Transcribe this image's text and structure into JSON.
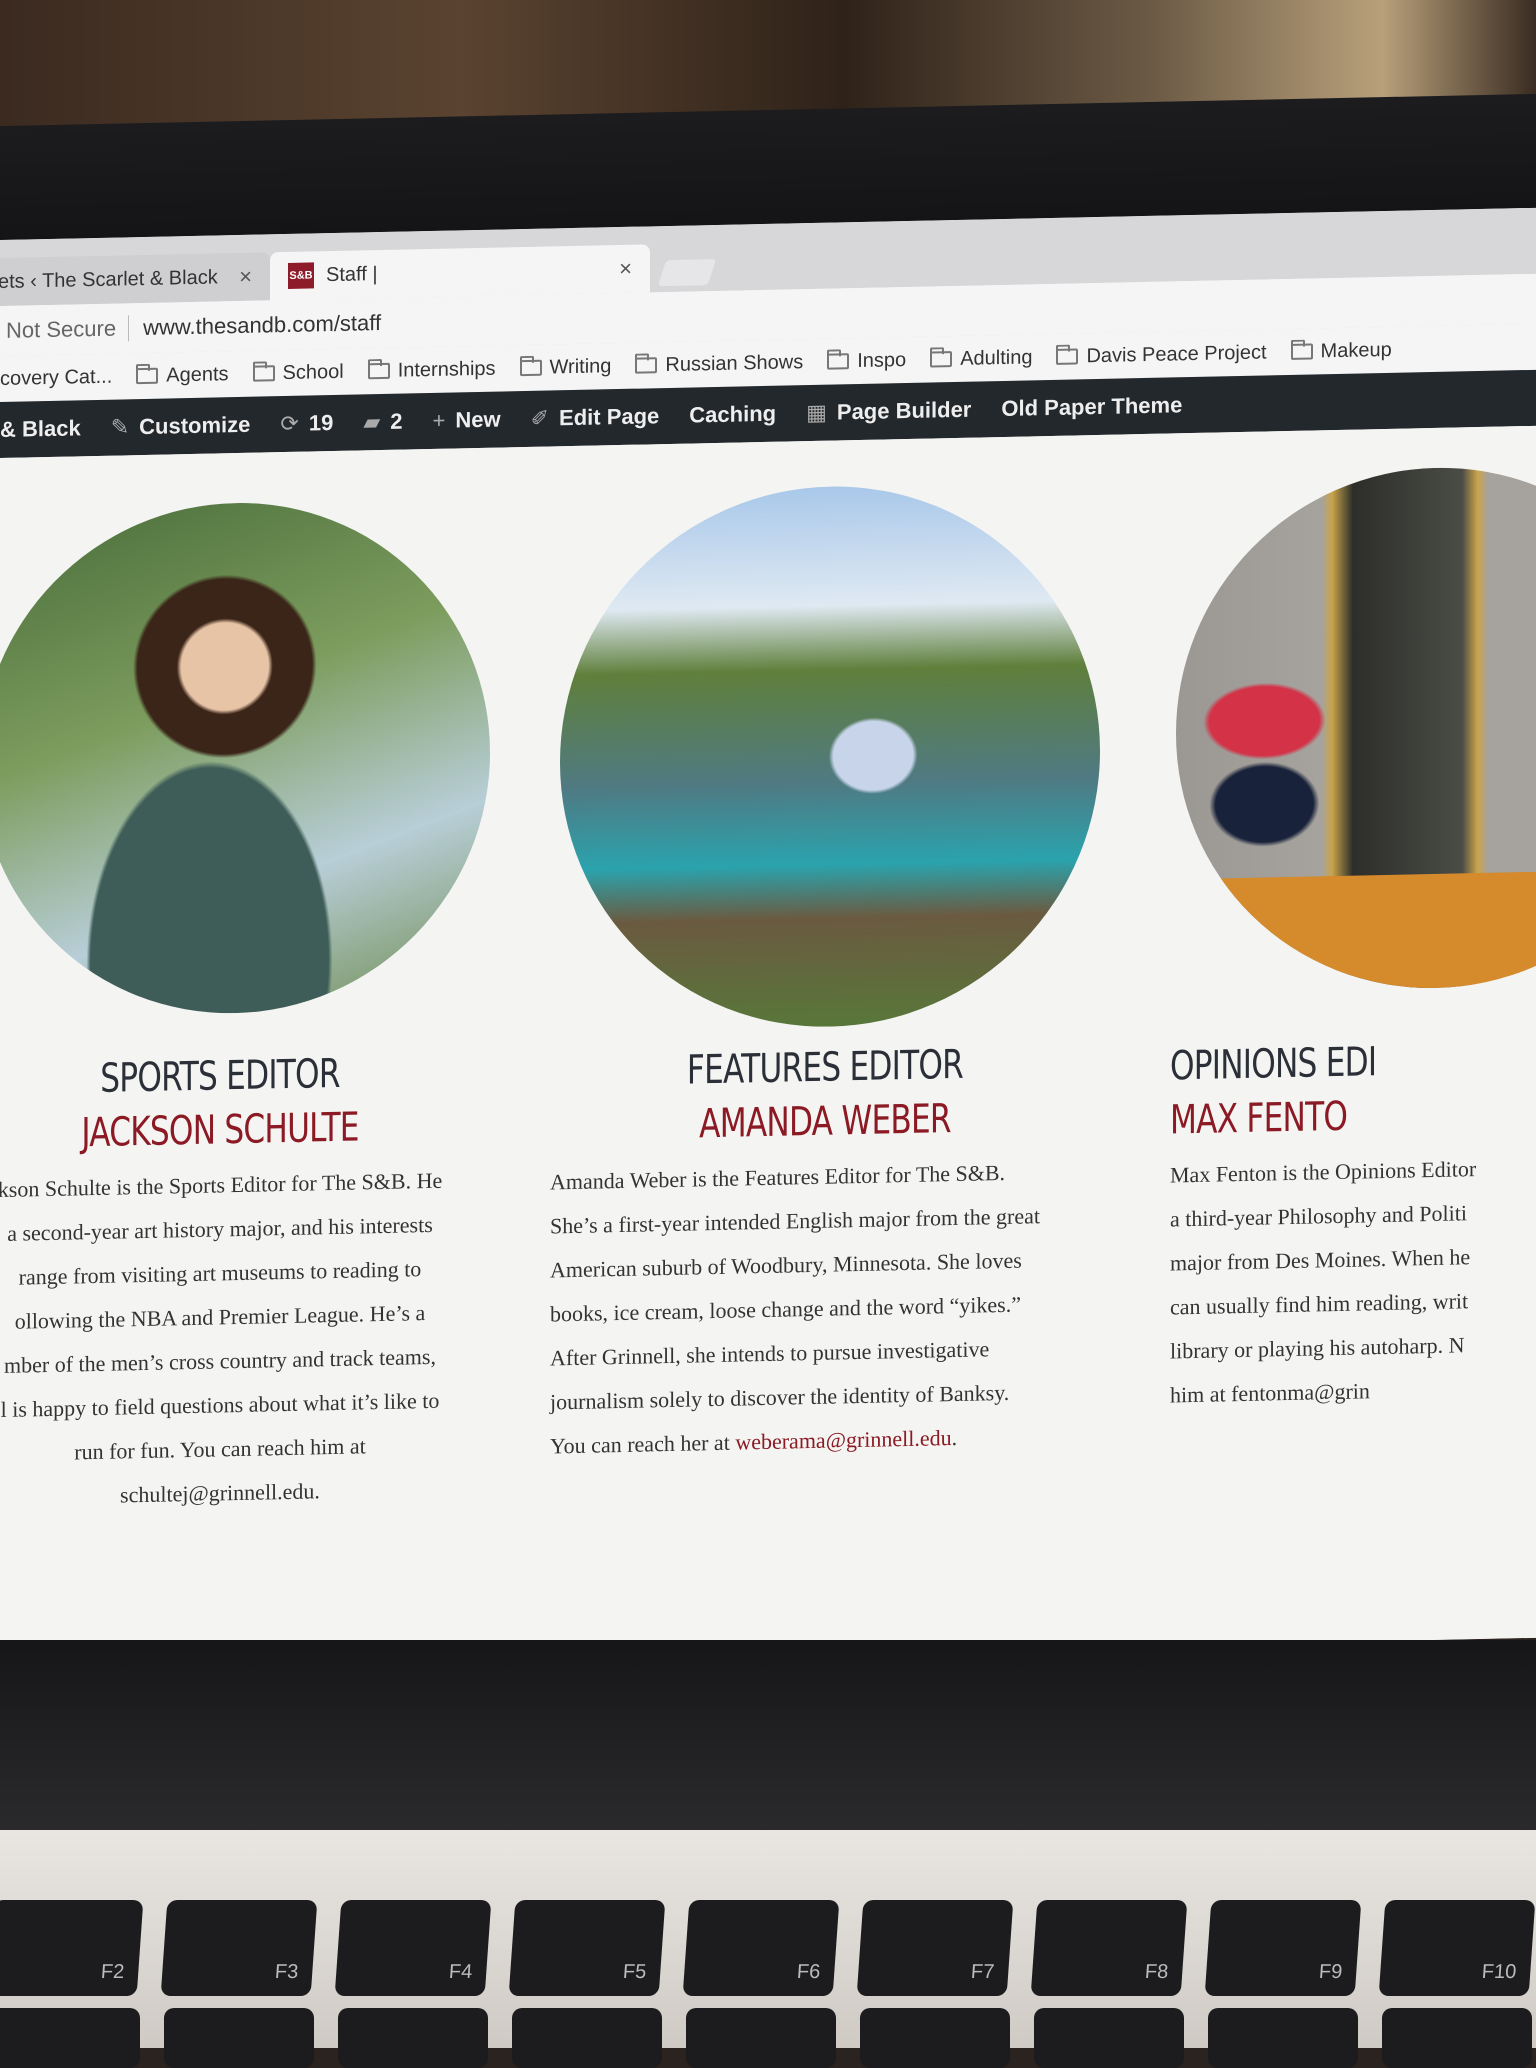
{
  "browser": {
    "tabs": [
      {
        "label": "ets ‹ The Scarlet & Black",
        "active": false
      },
      {
        "label": "Staff |",
        "active": true,
        "favicon": "S&B"
      }
    ],
    "address": {
      "security": "Not Secure",
      "url": "www.thesandb.com/staff"
    },
    "bookmarks": [
      "covery Cat...",
      "Agents",
      "School",
      "Internships",
      "Writing",
      "Russian Shows",
      "Inspo",
      "Adulting",
      "Davis Peace Project",
      "Makeup"
    ]
  },
  "admin_bar": {
    "site": "& Black",
    "customize": "Customize",
    "updates": "19",
    "comments": "2",
    "new": "New",
    "edit_page": "Edit Page",
    "caching": "Caching",
    "page_builder": "Page Builder",
    "theme": "Old Paper Theme"
  },
  "staff": [
    {
      "role": "SPORTS EDITOR",
      "name": "JACKSON SCHULTE",
      "bio": [
        "kson Schulte is the Sports Editor for The S&B. He",
        "a second-year art history major, and his interests",
        "range from visiting art museums to reading to",
        "ollowing the NBA and Premier League. He’s a",
        "mber of the men’s cross country and track teams,",
        "l is happy to field questions about what it’s like to",
        "run for fun. You can reach him at",
        "schultej@grinnell.edu."
      ]
    },
    {
      "role": "FEATURES EDITOR",
      "name": "AMANDA WEBER",
      "bio": [
        "Amanda Weber is the Features Editor for The S&B.",
        "She’s a first-year intended English major from the great",
        "American suburb of Woodbury, Minnesota. She loves",
        "books, ice cream, loose change and the word “yikes.”",
        "After Grinnell, she intends to pursue investigative",
        "journalism solely to discover the identity of Banksy."
      ],
      "contact_prefix": "You can reach her at ",
      "email": "weberama@grinnell.edu",
      "contact_suffix": "."
    },
    {
      "role": "OPINIONS EDI",
      "name": "MAX FENTO",
      "bio": [
        "Max Fenton is the Opinions Editor",
        "a third-year Philosophy and Politi",
        "major from Des Moines. When he",
        "can usually find him reading, writ",
        "library or playing his autoharp. N",
        "him at fentonma@grin"
      ]
    }
  ],
  "keyboard": [
    "F2",
    "F3",
    "F4",
    "F5",
    "F6",
    "F7",
    "F8",
    "F9",
    "F10"
  ]
}
